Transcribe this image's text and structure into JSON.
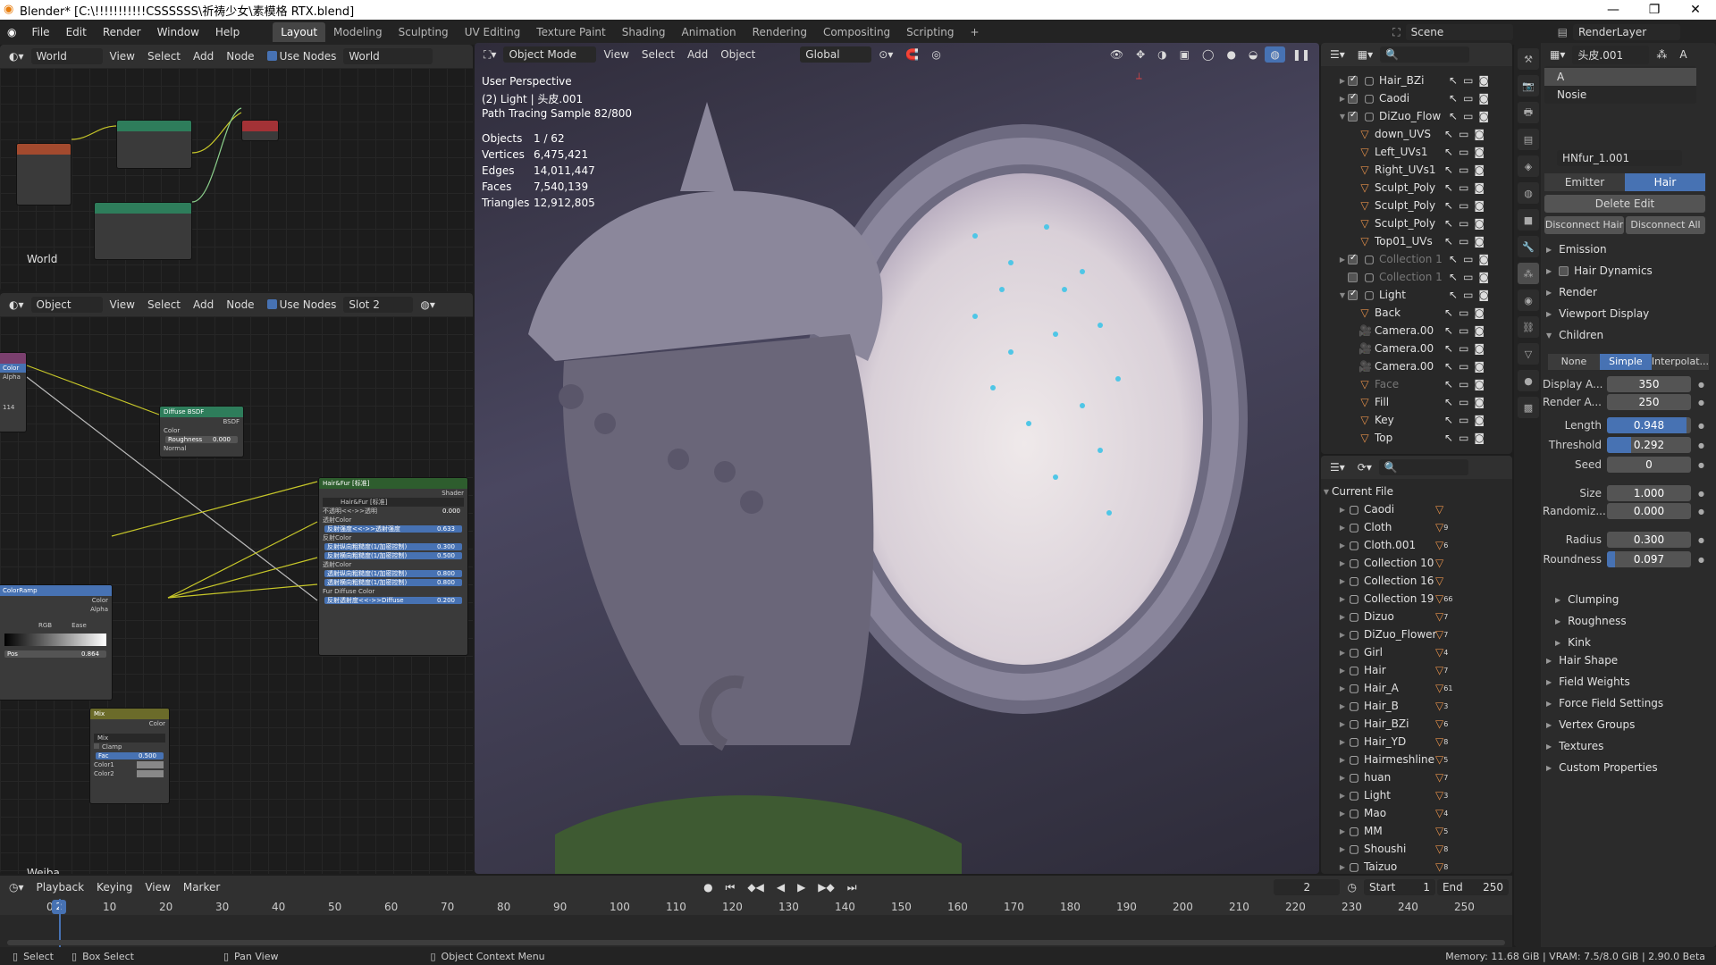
{
  "titlebar": {
    "title": "Blender* [C:\\!!!!!!!!!!!CSSSSSS\\祈祷少女\\素模格 RTX.blend]",
    "minimize": "—",
    "maximize": "❐",
    "close": "✕"
  },
  "menu": [
    "File",
    "Edit",
    "Render",
    "Window",
    "Help"
  ],
  "workspaces": [
    "Layout",
    "Modeling",
    "Sculpting",
    "UV Editing",
    "Texture Paint",
    "Shading",
    "Animation",
    "Rendering",
    "Compositing",
    "Scripting",
    "+"
  ],
  "scene": {
    "label": "Scene",
    "renderlayer": "RenderLayer"
  },
  "node_top": {
    "world_dd": "World",
    "view": "View",
    "select": "Select",
    "add": "Add",
    "node": "Node",
    "use_nodes": "Use Nodes",
    "world_name": "World",
    "footer": "World"
  },
  "node_bottom": {
    "object_dd": "Object",
    "view": "View",
    "select": "Select",
    "add": "Add",
    "node": "Node",
    "use_nodes": "Use Nodes",
    "slot": "Slot 2",
    "footer": "Weiba",
    "diffuse": {
      "title": "Diffuse BSDF",
      "out": "BSDF",
      "color": "Color",
      "roughness": "Roughness",
      "roughness_val": "0.000",
      "normal": "Normal"
    },
    "hair": {
      "title": "Hair&Fur [标准]",
      "out": "Shader",
      "sel": "Hair&Fur [标准]",
      "rows": [
        {
          "l": "不透明<<->>透明",
          "v": "0.000",
          "b": false
        },
        {
          "l": "透射Color",
          "v": "",
          "b": false
        },
        {
          "l": "反射强度<<->>透射强度",
          "v": "0.633",
          "b": true
        },
        {
          "l": "反射Color",
          "v": "",
          "b": false
        },
        {
          "l": "反射纵向粗糙度(1/加密控制)",
          "v": "0.300",
          "b": true
        },
        {
          "l": "反射横向粗糙度(1/加密控制)",
          "v": "0.500",
          "b": true
        },
        {
          "l": "透射Color",
          "v": "",
          "b": false
        },
        {
          "l": "透射纵向粗糙度(1/加密控制)",
          "v": "0.800",
          "b": true
        },
        {
          "l": "透射横向粗糙度(1/加密控制)",
          "v": "0.800",
          "b": true
        },
        {
          "l": "Fur Diffuse Color",
          "v": "",
          "b": false
        },
        {
          "l": "反射透射度<<->>Diffuse",
          "v": "0.200",
          "b": true
        }
      ]
    },
    "mix": {
      "title": "Mix",
      "out": "Color",
      "mode": "Mix",
      "clamp": "Clamp",
      "fac": "Fac",
      "fac_val": "0.500",
      "c1": "Color1",
      "c2": "Color2"
    },
    "ramp": {
      "title": "ColorRamp",
      "color": "Color",
      "alpha": "Alpha",
      "mode": "RGB",
      "interp": "Ease",
      "pos": "Pos",
      "pos_val": "0.864"
    },
    "left_in": {
      "color": "Color",
      "alpha": "Alpha",
      "val": "114"
    }
  },
  "viewport_header": {
    "mode": "Object Mode",
    "view": "View",
    "select": "Select",
    "add": "Add",
    "object": "Object",
    "orient": "Global"
  },
  "viewport_stats": {
    "line1": "User Perspective",
    "line2": "(2) Light | 头皮.001",
    "line3": "Path Tracing Sample 82/800",
    "rows": [
      {
        "k": "Objects",
        "v": "1 / 62"
      },
      {
        "k": "Vertices",
        "v": "6,475,421"
      },
      {
        "k": "Edges",
        "v": "14,011,447"
      },
      {
        "k": "Faces",
        "v": "7,540,139"
      },
      {
        "k": "Triangles",
        "v": "12,912,805"
      }
    ]
  },
  "outliner_top": [
    {
      "name": "Hair_BZi",
      "ind": 1,
      "exp": "▶",
      "chk": true,
      "ico": "col",
      "dim": false
    },
    {
      "name": "Caodi",
      "ind": 1,
      "exp": "▶",
      "chk": true,
      "ico": "col",
      "dim": false
    },
    {
      "name": "DiZuo_Flow",
      "ind": 1,
      "exp": "▼",
      "chk": true,
      "ico": "col",
      "dim": false
    },
    {
      "name": "down_UVS",
      "ind": 2,
      "exp": "",
      "chk": false,
      "ico": "mesh",
      "dim": false
    },
    {
      "name": "Left_UVs1",
      "ind": 2,
      "exp": "",
      "chk": false,
      "ico": "mesh",
      "dim": false
    },
    {
      "name": "Right_UVs1",
      "ind": 2,
      "exp": "",
      "chk": false,
      "ico": "mesh",
      "dim": false
    },
    {
      "name": "Sculpt_Poly",
      "ind": 2,
      "exp": "",
      "chk": false,
      "ico": "mesh",
      "dim": false
    },
    {
      "name": "Sculpt_Poly",
      "ind": 2,
      "exp": "",
      "chk": false,
      "ico": "mesh",
      "dim": false
    },
    {
      "name": "Sculpt_Poly",
      "ind": 2,
      "exp": "",
      "chk": false,
      "ico": "mesh",
      "dim": false
    },
    {
      "name": "Top01_UVs",
      "ind": 2,
      "exp": "",
      "chk": false,
      "ico": "mesh",
      "dim": false
    },
    {
      "name": "Collection 1",
      "ind": 1,
      "exp": "▶",
      "chk": true,
      "ico": "col",
      "dim": true
    },
    {
      "name": "Collection 1",
      "ind": 1,
      "exp": "",
      "chk": false,
      "ico": "col",
      "dim": true
    },
    {
      "name": "Light",
      "ind": 1,
      "exp": "▼",
      "chk": true,
      "ico": "col",
      "dim": false
    },
    {
      "name": "Back",
      "ind": 2,
      "exp": "",
      "chk": false,
      "ico": "mesh",
      "dim": false
    },
    {
      "name": "Camera.00",
      "ind": 2,
      "exp": "",
      "chk": false,
      "ico": "cam",
      "dim": false
    },
    {
      "name": "Camera.00",
      "ind": 2,
      "exp": "",
      "chk": false,
      "ico": "cam",
      "dim": false
    },
    {
      "name": "Camera.00",
      "ind": 2,
      "exp": "",
      "chk": false,
      "ico": "cam",
      "dim": false
    },
    {
      "name": "Face",
      "ind": 2,
      "exp": "",
      "chk": false,
      "ico": "mesh",
      "dim": true
    },
    {
      "name": "Fill",
      "ind": 2,
      "exp": "",
      "chk": false,
      "ico": "mesh",
      "dim": false
    },
    {
      "name": "Key",
      "ind": 2,
      "exp": "",
      "chk": false,
      "ico": "mesh",
      "dim": false
    },
    {
      "name": "Top",
      "ind": 2,
      "exp": "",
      "chk": false,
      "ico": "mesh",
      "dim": false
    }
  ],
  "outliner_bottom": {
    "root": "Current File",
    "items": [
      {
        "name": "Caodi",
        "badge": ""
      },
      {
        "name": "Cloth",
        "badge": "9"
      },
      {
        "name": "Cloth.001",
        "badge": "6"
      },
      {
        "name": "Collection 10",
        "badge": ""
      },
      {
        "name": "Collection 16",
        "badge": ""
      },
      {
        "name": "Collection 19",
        "badge": "66"
      },
      {
        "name": "Dizuo",
        "badge": "7"
      },
      {
        "name": "DiZuo_Flower",
        "badge": "7"
      },
      {
        "name": "Girl",
        "badge": "4"
      },
      {
        "name": "Hair",
        "badge": "7"
      },
      {
        "name": "Hair_A",
        "badge": "61"
      },
      {
        "name": "Hair_B",
        "badge": "3"
      },
      {
        "name": "Hair_BZi",
        "badge": "6"
      },
      {
        "name": "Hair_YD",
        "badge": "8"
      },
      {
        "name": "Hairmeshline",
        "badge": "5"
      },
      {
        "name": "huan",
        "badge": "7"
      },
      {
        "name": "Light",
        "badge": "3"
      },
      {
        "name": "Mao",
        "badge": "4"
      },
      {
        "name": "MM",
        "badge": "5"
      },
      {
        "name": "Shoushi",
        "badge": "8"
      },
      {
        "name": "Taizuo",
        "badge": "8"
      }
    ]
  },
  "props": {
    "object": "头皮.001",
    "sys_a": "A",
    "particle_list": [
      "A",
      "Nosie"
    ],
    "particle_settings": "HNfur_1.001",
    "emitter": "Emitter",
    "hair": "Hair",
    "delete_edit": "Delete Edit",
    "disconnect_hair": "Disconnect Hair",
    "disconnect_all": "Disconnect All",
    "sections_top": [
      "Emission",
      "Hair Dynamics",
      "Render",
      "Viewport Display",
      "Children"
    ],
    "children_modes": [
      "None",
      "Simple",
      "Interpolat..."
    ],
    "fields": [
      {
        "l": "Display A...",
        "v": "350",
        "fill": 0
      },
      {
        "l": "Render A...",
        "v": "250",
        "fill": 0
      },
      {
        "l": "Length",
        "v": "0.948",
        "fill": 0.948
      },
      {
        "l": "Threshold",
        "v": "0.292",
        "fill": 0.292
      },
      {
        "l": "Seed",
        "v": "0",
        "fill": 0
      },
      {
        "l": "Size",
        "v": "1.000",
        "fill": 0
      },
      {
        "l": "Randomiz...",
        "v": "0.000",
        "fill": 0
      },
      {
        "l": "Radius",
        "v": "0.300",
        "fill": 0
      },
      {
        "l": "Roundness",
        "v": "0.097",
        "fill": 0.097
      }
    ],
    "sub_sections": [
      "Clumping",
      "Roughness",
      "Kink"
    ],
    "sections_bottom": [
      "Hair Shape",
      "Field Weights",
      "Force Field Settings",
      "Vertex Groups",
      "Textures",
      "Custom Properties"
    ]
  },
  "timeline": {
    "playback": "Playback",
    "keying": "Keying",
    "view": "View",
    "marker": "Marker",
    "current": "2",
    "start_label": "Start",
    "start": "1",
    "end_label": "End",
    "end": "250",
    "ticks": [
      "0",
      "10",
      "20",
      "30",
      "40",
      "50",
      "60",
      "70",
      "80",
      "90",
      "100",
      "110",
      "120",
      "130",
      "140",
      "150",
      "160",
      "170",
      "180",
      "190",
      "200",
      "210",
      "220",
      "230",
      "240",
      "250"
    ]
  },
  "status": {
    "select": "Select",
    "box_select": "Box Select",
    "pan_view": "Pan View",
    "context_menu": "Object Context Menu",
    "memory": "Memory: 11.68 GiB | VRAM: 7.5/8.0 GiB | 2.90.0 Beta"
  },
  "colors": {
    "accent": "#4772b3",
    "orange": "#e5904a",
    "teal_node": "#2e7d5b",
    "viewport_bg": "#4a4760"
  }
}
